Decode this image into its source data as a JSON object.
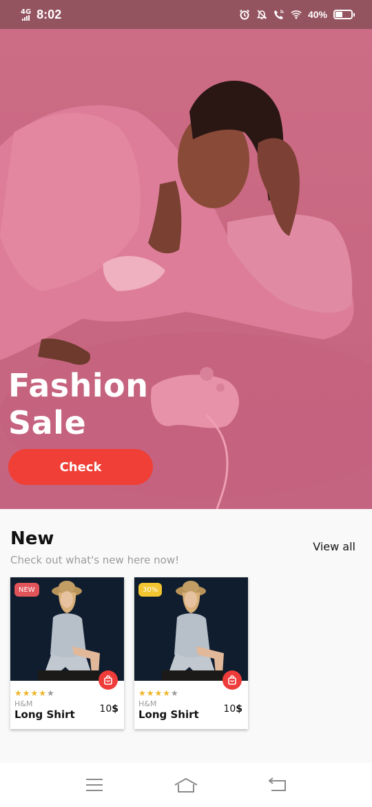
{
  "status_bar": {
    "network": "4G",
    "time": "8:02",
    "battery_percent": "40%",
    "icons": [
      "alarm-icon",
      "notifications-off-icon",
      "wifi-calling-icon",
      "wifi-icon",
      "battery-icon"
    ]
  },
  "hero": {
    "title_line1": "Fashion",
    "title_line2": "Sale",
    "button_label": "Check",
    "accent_color": "#ef3f36"
  },
  "new_section": {
    "title": "New",
    "subtitle": "Check out what's new here now!",
    "view_all_label": "View all"
  },
  "products": [
    {
      "badge": "NEW",
      "badge_color": "#e0545a",
      "rating": 4,
      "max_rating": 5,
      "stars_on": "★★★★",
      "stars_off": "★",
      "brand": "H&M",
      "name": "Long Shirt",
      "price_value": "10",
      "price_currency": "$"
    },
    {
      "badge": "30%",
      "badge_color": "#f3c530",
      "rating": 4,
      "max_rating": 5,
      "stars_on": "★★★★",
      "stars_off": "★",
      "brand": "H&M",
      "name": "Long Shirt",
      "price_value": "10",
      "price_currency": "$"
    }
  ],
  "navigation": {
    "icons": [
      "menu-icon",
      "home-icon",
      "back-icon"
    ]
  }
}
